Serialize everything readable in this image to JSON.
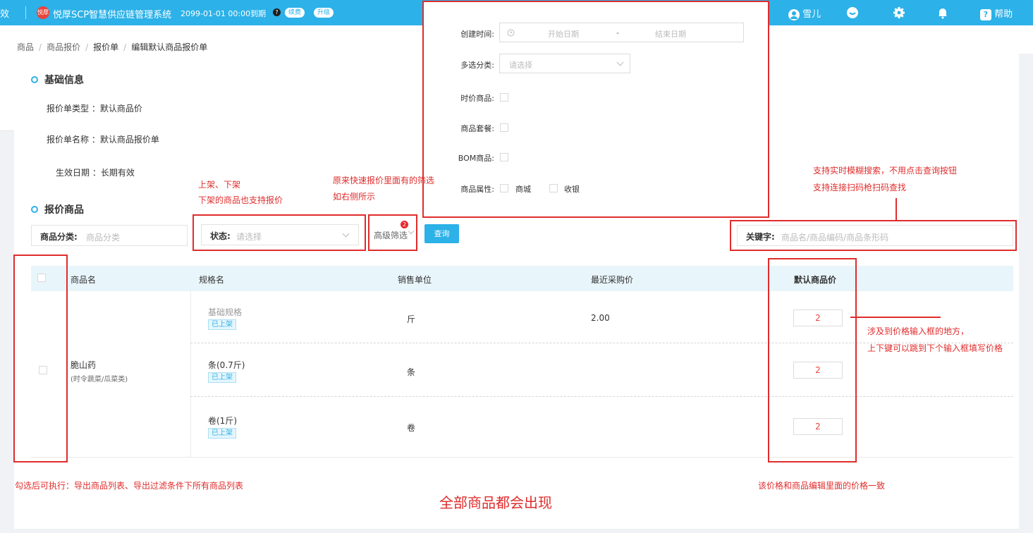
{
  "topbar": {
    "edge_text": "效",
    "logo_text": "悦厚",
    "system_title": "悦厚SCP智慧供应链管理系统",
    "expire_text": "2099-01-01 00:00到期",
    "renew_label": "续费",
    "upgrade_label": "升级",
    "user_name": "雪儿",
    "help_label": "帮助",
    "help_icon_text": "?",
    "question_icon_text": "?"
  },
  "breadcrumb": {
    "items": [
      "商品",
      "商品报价",
      "报价单",
      "编辑默认商品报价单"
    ],
    "separator": "/"
  },
  "basic_info": {
    "title": "基础信息",
    "type_label": "报价单类型 ：",
    "type_value": "默认商品价",
    "name_label": "报价单名称 ：",
    "name_value": "默认商品报价单",
    "date_label": "生效日期 ：",
    "date_value": "长期有效"
  },
  "quote_goods": {
    "title": "报价商品"
  },
  "filters": {
    "category_label": "商品分类:",
    "category_placeholder": "商品分类",
    "status_label": "状态:",
    "status_placeholder": "请选择",
    "advanced_label": "高级筛选",
    "advanced_badge": "2",
    "query_label": "查询",
    "keyword_label": "关键字:",
    "keyword_placeholder": "商品名/商品编码/商品条形码"
  },
  "table": {
    "headers": [
      "商品名",
      "规格名",
      "销售单位",
      "最近采购价",
      "默认商品价"
    ],
    "product_name": "脆山药",
    "product_category": "(时令蔬菜/瓜菜类)",
    "rows": [
      {
        "spec": "基础规格",
        "tag": "已上架",
        "unit": "斤",
        "last_price": "2.00",
        "price": "2"
      },
      {
        "spec": "条(0.7斤)",
        "tag": "已上架",
        "unit": "条",
        "last_price": "",
        "price": "2"
      },
      {
        "spec": "卷(1斤)",
        "tag": "已上架",
        "unit": "卷",
        "last_price": "",
        "price": "2"
      }
    ]
  },
  "advanced_panel": {
    "create_time_label": "创建时间:",
    "start_placeholder": "开始日期",
    "range_sep": "-",
    "end_placeholder": "结束日期",
    "multi_cat_label": "多选分类:",
    "multi_cat_placeholder": "请选择",
    "time_price_label": "时价商品:",
    "package_label": "商品套餐:",
    "bom_label": "BOM商品:",
    "attr_label": "商品属性:",
    "attr_mall": "商城",
    "attr_cashier": "收银"
  },
  "annotations": {
    "status_note_1": "上架、下架",
    "status_note_2": "下架的商品也支持报价",
    "adv_note_1": "原来快速报价里面有的筛选",
    "adv_note_2": "如右侧所示",
    "search_note_1": "支持实时模糊搜索，不用点击查询按钮",
    "search_note_2": "支持连接扫码枪扫码查找",
    "price_note_1": "涉及到价格输入框的地方，",
    "price_note_2": "上下键可以跳到下个输入框填写价格",
    "check_note": "勾选后可执行：导出商品列表、导出过滤条件下所有商品列表",
    "all_goods_note": "全部商品都会出现",
    "price_same_note": "该价格和商品编辑里面的价格一致"
  },
  "colors": {
    "topbar": "#2cb1e8",
    "annotation": "#e02c2c",
    "price_text": "#e8453c"
  }
}
